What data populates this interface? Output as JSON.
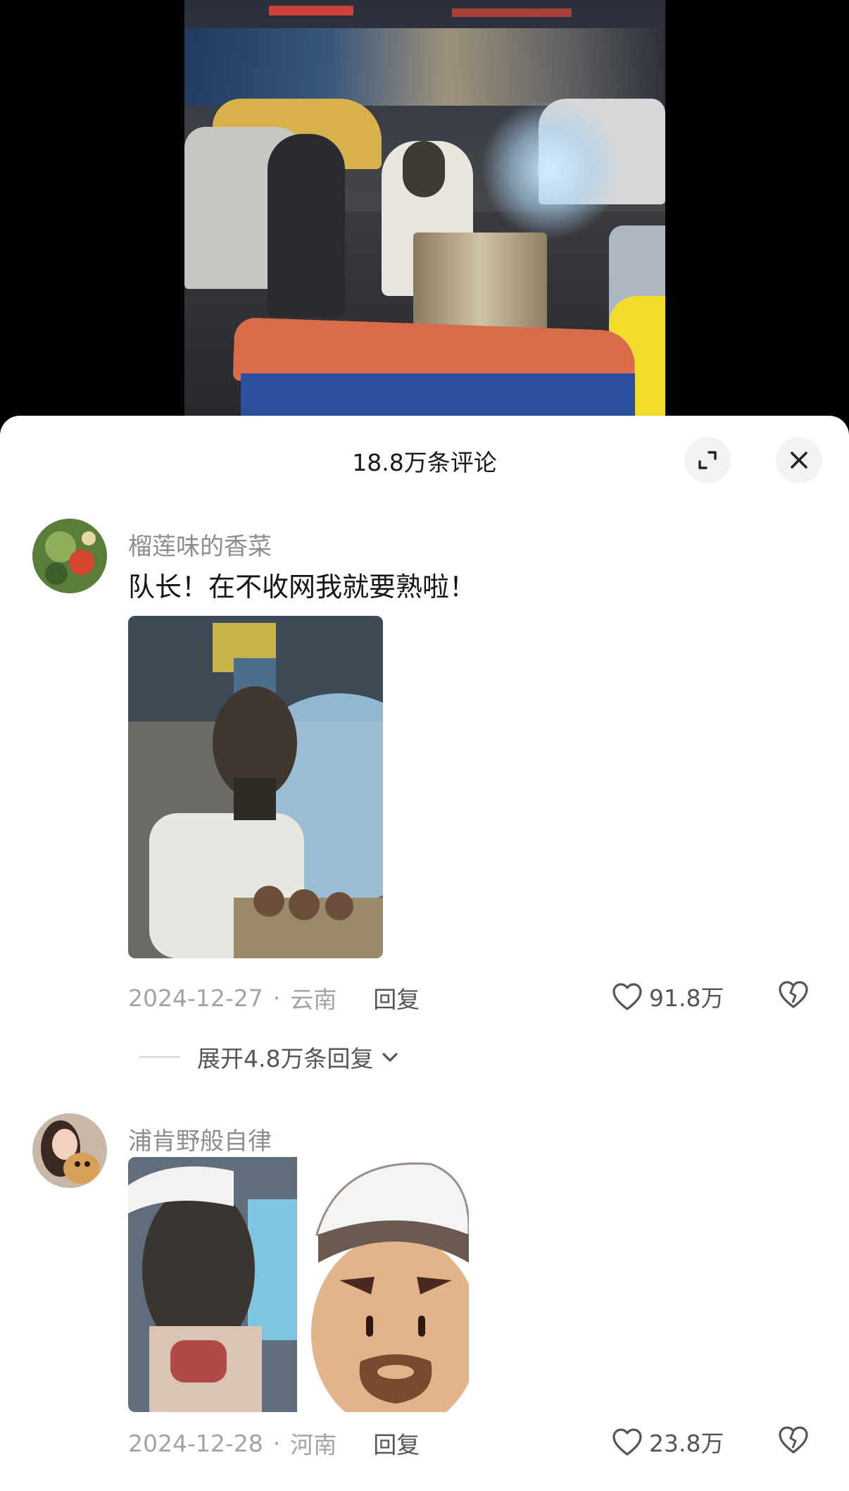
{
  "sheet": {
    "title": "18.8万条评论",
    "expand_icon": "expand-icon",
    "close_icon": "close-icon"
  },
  "comments": [
    {
      "username": "榴莲味的香菜",
      "text": "队长！在不收网我就要熟啦！",
      "date": "2024-12-27",
      "location": "云南",
      "reply_label": "回复",
      "likes": "91.8万",
      "expand_replies": "展开4.8万条回复"
    },
    {
      "username": "浦肯野般自律",
      "date": "2024-12-28",
      "location": "河南",
      "reply_label": "回复",
      "likes": "23.8万"
    }
  ],
  "colors": {
    "sheet_bg": "#ffffff",
    "username": "#8d8d8d",
    "meta": "#a3a3a3"
  }
}
